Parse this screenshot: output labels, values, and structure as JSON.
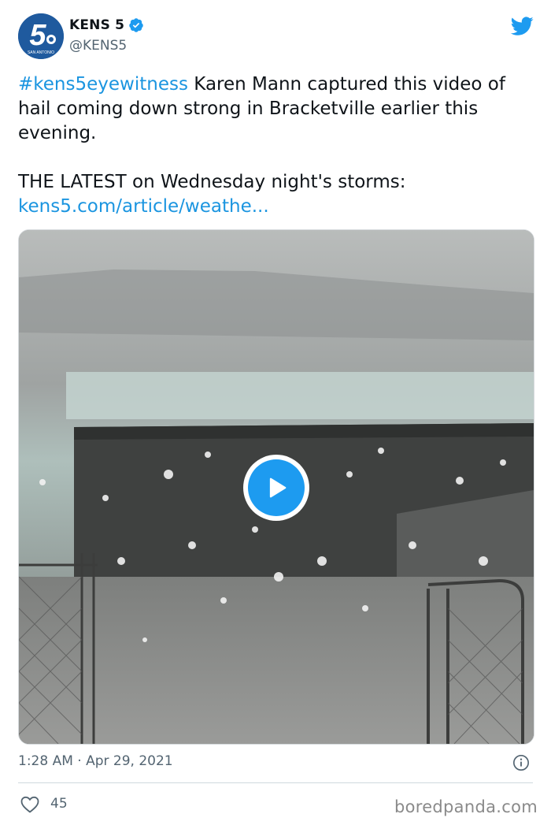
{
  "account": {
    "display_name": "KENS 5",
    "handle": "@KENS5",
    "verified": true,
    "avatar_logo_text": "5",
    "avatar_sub_text": "SAN ANTONIO"
  },
  "tweet": {
    "hashtag": "#kens5eyewitness",
    "line1_rest": " Karen Mann captured this video of hail coming down strong in Bracketville earlier this evening.",
    "line2": "THE LATEST on Wednesday night's storms:",
    "link_text": "kens5.com/article/weathe..."
  },
  "media": {
    "type": "video",
    "play_icon": "play-icon"
  },
  "footer": {
    "timestamp": "1:28 AM · Apr 29, 2021",
    "likes": "45"
  },
  "watermark": "boredpanda.com",
  "colors": {
    "link": "#1b95e0",
    "play": "#1d9bf0",
    "verified": "#1d9bf0",
    "brand_blue": "#1f5a9e"
  }
}
